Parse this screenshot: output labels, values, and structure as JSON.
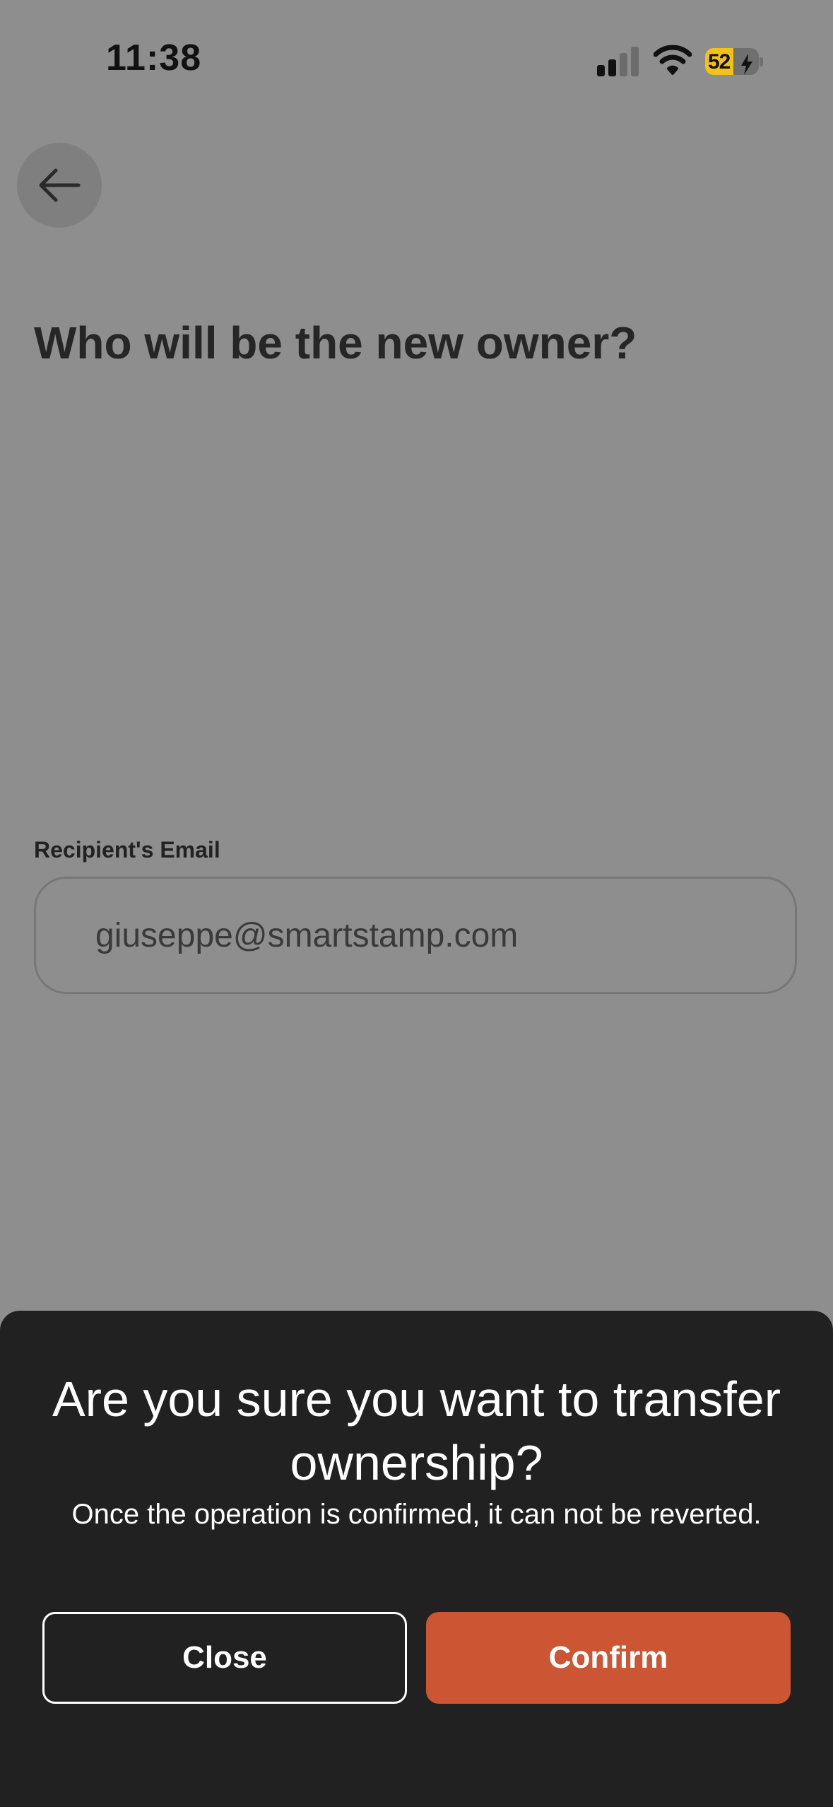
{
  "status_bar": {
    "time": "11:38",
    "battery_level": "52",
    "battery_fraction": 0.52,
    "signal_bars_active": 2,
    "signal_bars_total": 4,
    "icons": [
      "cellular-signal-icon",
      "wifi-icon",
      "battery-charging-icon"
    ]
  },
  "header": {
    "back_icon": "arrow-left-icon"
  },
  "page": {
    "title": "Who will be the new owner?",
    "email_label": "Recipient's Email",
    "email_value": "giuseppe@smartstamp.com"
  },
  "modal": {
    "title": "Are you sure you want to transfer ownership?",
    "message": "Once the operation is confirmed, it can not be reverted.",
    "close_label": "Close",
    "confirm_label": "Confirm"
  },
  "colors": {
    "dim_background": "#8e8e8e",
    "modal_background": "#212121",
    "confirm_accent": "#cc5533",
    "battery_accent": "#f2c21b"
  }
}
